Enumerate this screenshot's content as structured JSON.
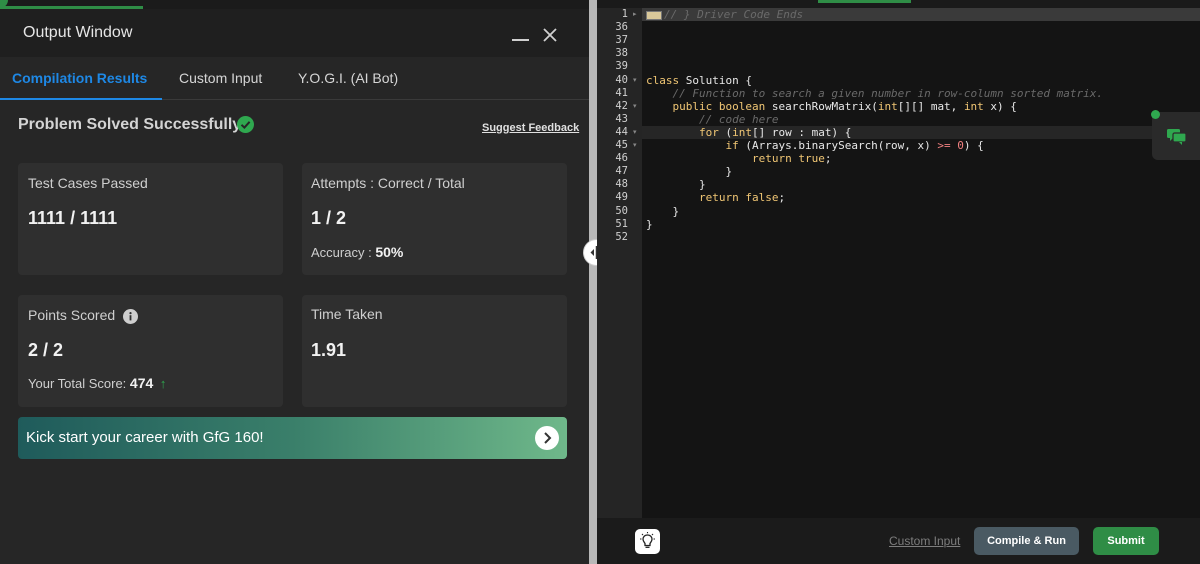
{
  "output_window": {
    "title": "Output Window",
    "tabs": [
      {
        "label": "Compilation Results"
      },
      {
        "label": "Custom Input"
      },
      {
        "label": "Y.O.G.I. (AI Bot)"
      }
    ],
    "status_text": "Problem Solved Successfully",
    "suggest_feedback": "Suggest Feedback",
    "cards": {
      "test_cases": {
        "label": "Test Cases Passed",
        "value": "1111 / 1111"
      },
      "attempts": {
        "label": "Attempts : Correct / Total",
        "value": "1 / 2",
        "sub_label": "Accuracy :",
        "sub_value": "50%"
      },
      "points": {
        "label": "Points Scored",
        "value": "2 / 2",
        "sub_label": "Your Total Score:",
        "sub_value": "474",
        "trend_icon": "arrow-up-icon"
      },
      "time": {
        "label": "Time Taken",
        "value": "1.91"
      }
    },
    "banner_text": "Kick start your career with GfG 160!"
  },
  "editor": {
    "line_numbers": [
      "1",
      "36",
      "37",
      "38",
      "39",
      "40",
      "41",
      "42",
      "43",
      "44",
      "45",
      "46",
      "47",
      "48",
      "49",
      "50",
      "51",
      "52"
    ],
    "lines": [
      "// } Driver Code Ends",
      "",
      "",
      "",
      "",
      "class Solution {",
      "    // Function to search a given number in row-column sorted matrix.",
      "    public boolean searchRowMatrix(int[][] mat, int x) {",
      "        // code here",
      "        for (int[] row : mat) {",
      "            if (Arrays.binarySearch(row, x) >= 0) {",
      "                return true;",
      "            }",
      "        }",
      "        return false;",
      "    }",
      "}",
      ""
    ]
  },
  "footer": {
    "custom_input_link": "Custom Input",
    "compile_run": "Compile & Run",
    "submit": "Submit"
  },
  "colors": {
    "accent_blue": "#1e88e5",
    "success_green": "#2f8d46",
    "panel_bg": "#262626",
    "editor_bg": "#141414"
  }
}
